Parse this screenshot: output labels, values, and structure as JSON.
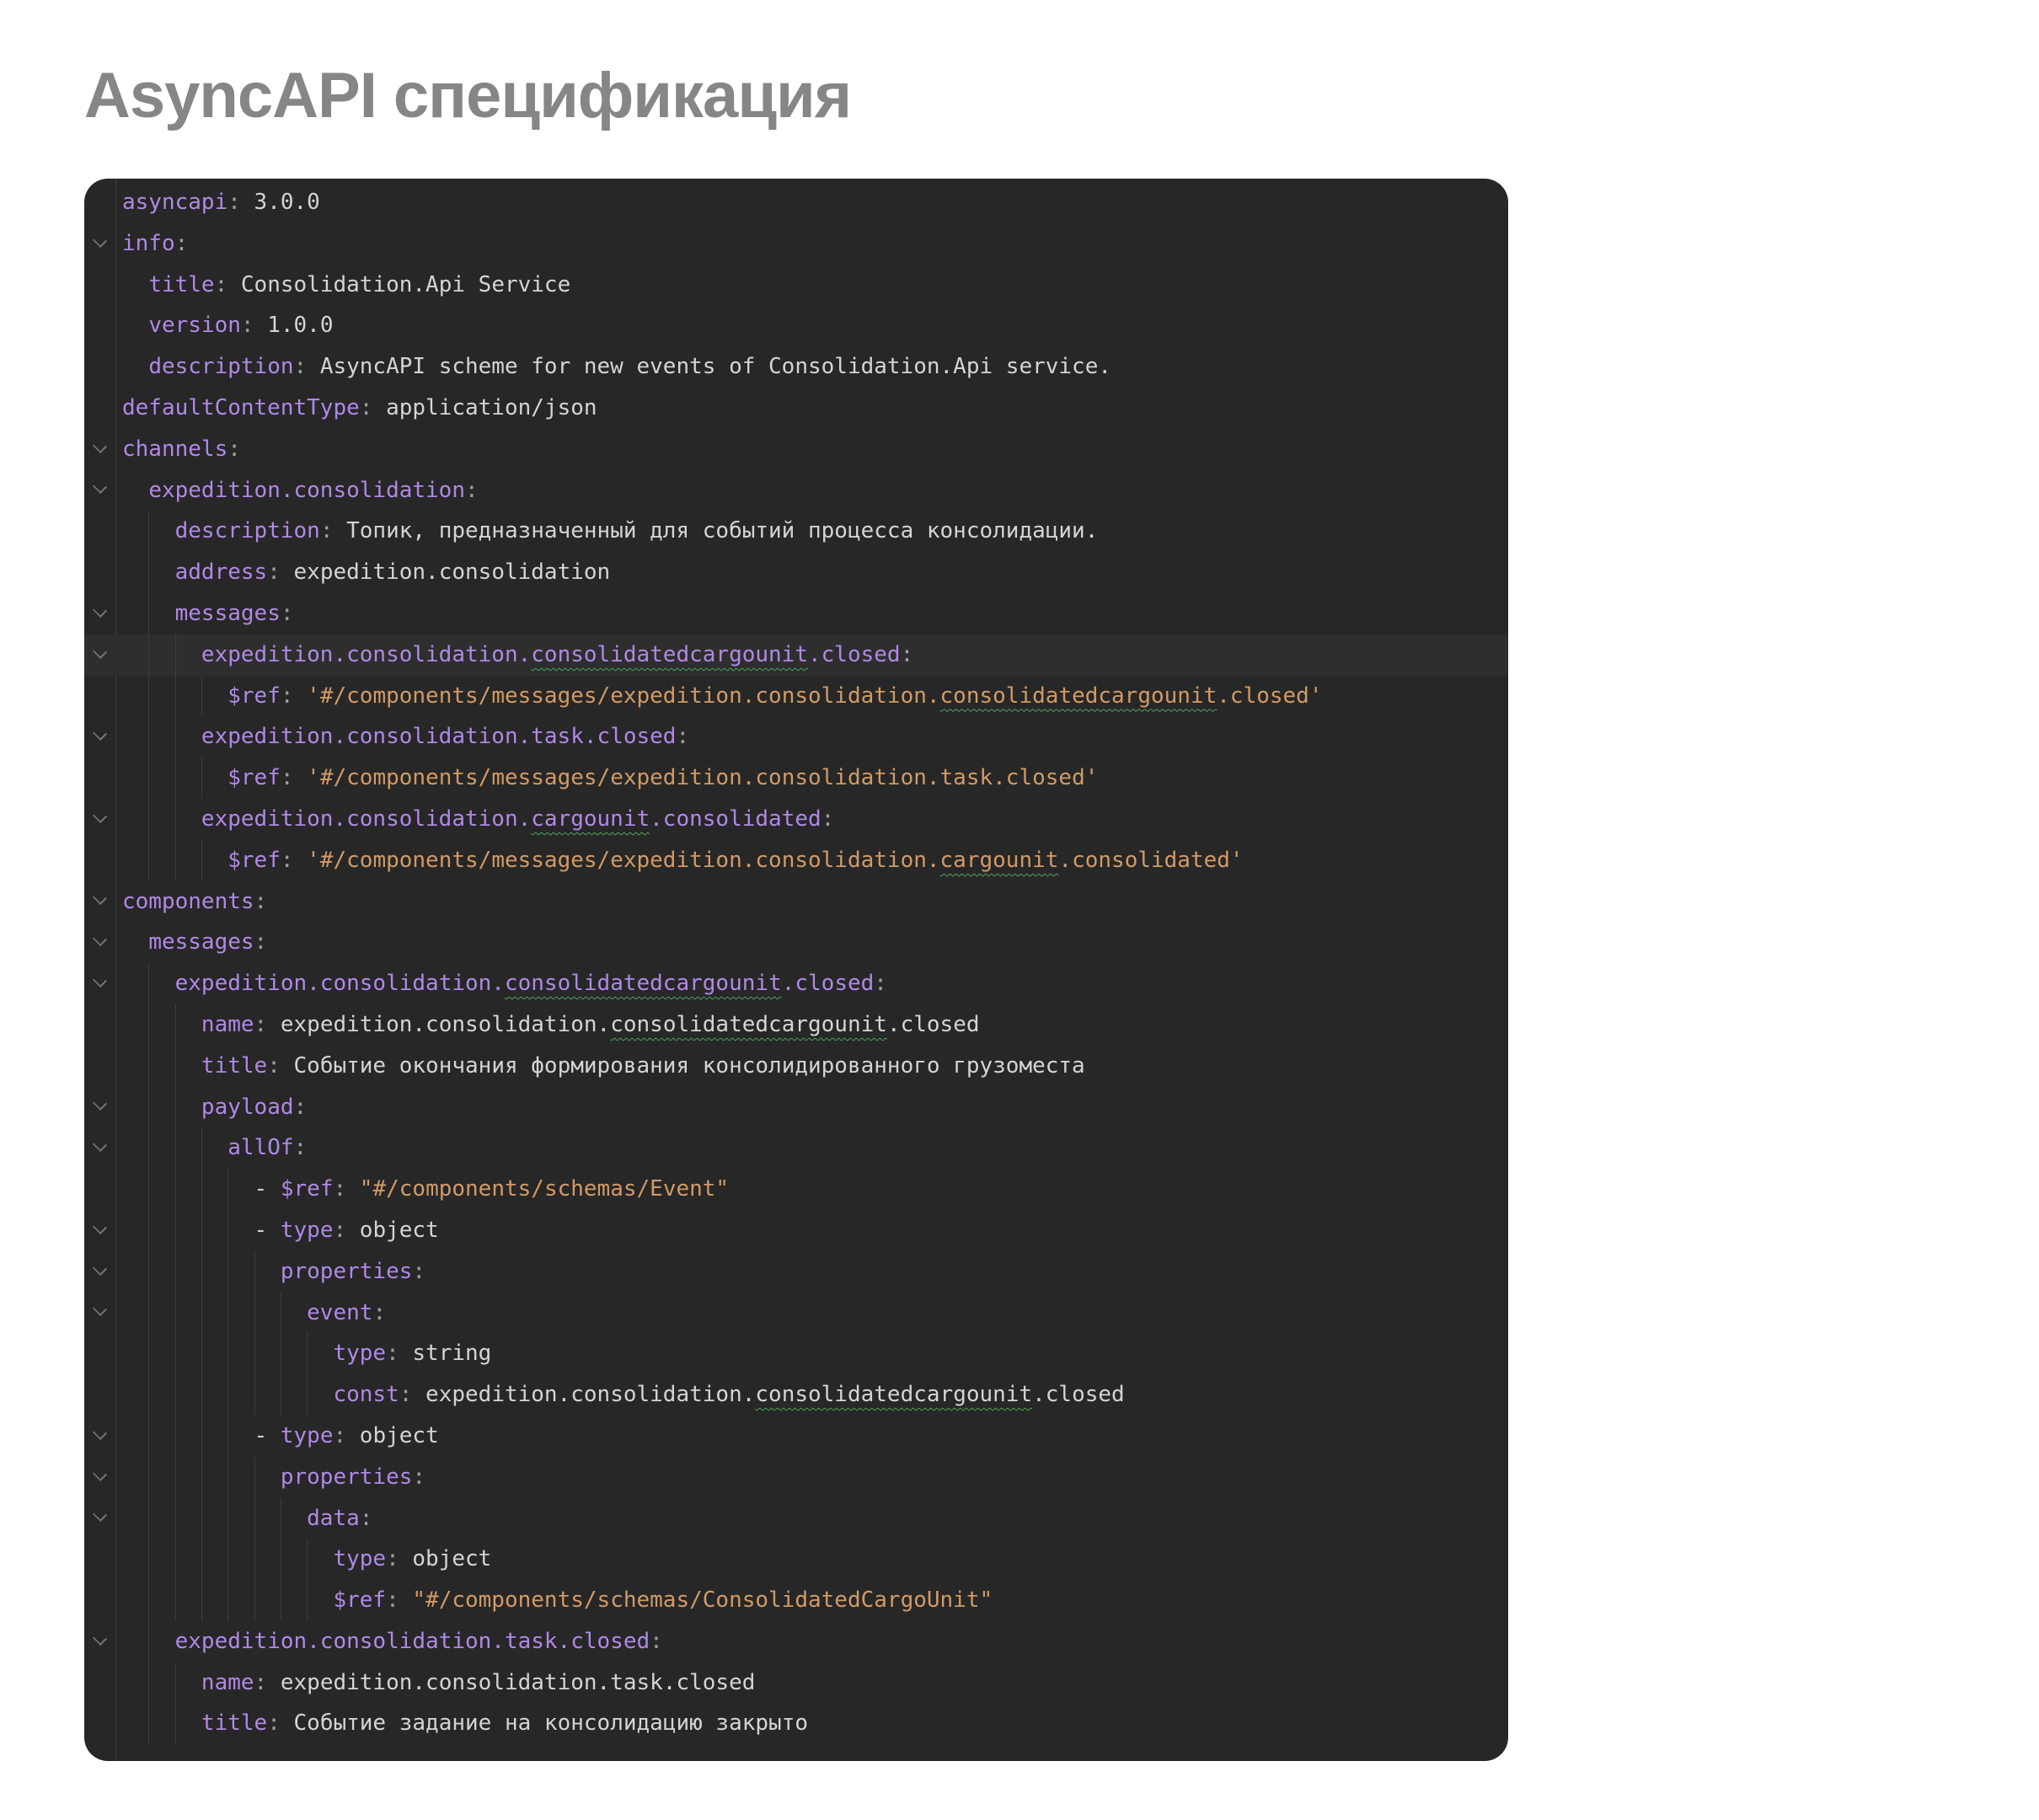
{
  "title": "AsyncAPI спецификация",
  "colors": {
    "heading": "#868686",
    "page-bg": "#ffffff",
    "code-bg": "#272727",
    "line-highlight": "#2e2e2e",
    "key": "#b088e6",
    "value": "#d4d4d4",
    "string": "#d19a66",
    "punct": "#9e9e9e",
    "guide": "#3d3d3d",
    "chevron": "#757575",
    "squiggle": "#4fa457"
  },
  "code": {
    "lines": [
      {
        "indent": 0,
        "fold": false,
        "highlight": false,
        "segments": [
          {
            "c": "key",
            "t": "asyncapi"
          },
          {
            "c": "punct",
            "t": ": "
          },
          {
            "c": "val",
            "t": "3.0.0"
          }
        ]
      },
      {
        "indent": 0,
        "fold": true,
        "highlight": false,
        "segments": [
          {
            "c": "key",
            "t": "info"
          },
          {
            "c": "punct",
            "t": ":"
          }
        ]
      },
      {
        "indent": 2,
        "fold": false,
        "highlight": false,
        "segments": [
          {
            "c": "key",
            "t": "title"
          },
          {
            "c": "punct",
            "t": ": "
          },
          {
            "c": "val",
            "t": "Consolidation.Api Service"
          }
        ]
      },
      {
        "indent": 2,
        "fold": false,
        "highlight": false,
        "segments": [
          {
            "c": "key",
            "t": "version"
          },
          {
            "c": "punct",
            "t": ": "
          },
          {
            "c": "val",
            "t": "1.0.0"
          }
        ]
      },
      {
        "indent": 2,
        "fold": false,
        "highlight": false,
        "segments": [
          {
            "c": "key",
            "t": "description"
          },
          {
            "c": "punct",
            "t": ": "
          },
          {
            "c": "val",
            "t": "AsyncAPI scheme for new events of Consolidation.Api service."
          }
        ]
      },
      {
        "indent": 0,
        "fold": false,
        "highlight": false,
        "segments": [
          {
            "c": "key",
            "t": "defaultContentType"
          },
          {
            "c": "punct",
            "t": ": "
          },
          {
            "c": "val",
            "t": "application/json"
          }
        ]
      },
      {
        "indent": 0,
        "fold": true,
        "highlight": false,
        "segments": [
          {
            "c": "key",
            "t": "channels"
          },
          {
            "c": "punct",
            "t": ":"
          }
        ]
      },
      {
        "indent": 2,
        "fold": true,
        "highlight": false,
        "segments": [
          {
            "c": "key",
            "t": "expedition.consolidation"
          },
          {
            "c": "punct",
            "t": ":"
          }
        ]
      },
      {
        "indent": 4,
        "fold": false,
        "highlight": false,
        "segments": [
          {
            "c": "key",
            "t": "description"
          },
          {
            "c": "punct",
            "t": ": "
          },
          {
            "c": "val",
            "t": "Топик, предназначенный для событий процесса консолидации."
          }
        ]
      },
      {
        "indent": 4,
        "fold": false,
        "highlight": false,
        "segments": [
          {
            "c": "key",
            "t": "address"
          },
          {
            "c": "punct",
            "t": ": "
          },
          {
            "c": "val",
            "t": "expedition.consolidation"
          }
        ]
      },
      {
        "indent": 4,
        "fold": true,
        "highlight": false,
        "segments": [
          {
            "c": "key",
            "t": "messages"
          },
          {
            "c": "punct",
            "t": ":"
          }
        ]
      },
      {
        "indent": 6,
        "fold": true,
        "highlight": true,
        "segments": [
          {
            "c": "key",
            "t": "expedition.consolidation."
          },
          {
            "c": "key",
            "t": "consolidatedcargounit",
            "w": true
          },
          {
            "c": "key",
            "t": ".closed"
          },
          {
            "c": "punct",
            "t": ":"
          }
        ]
      },
      {
        "indent": 8,
        "fold": false,
        "highlight": false,
        "segments": [
          {
            "c": "key",
            "t": "$ref"
          },
          {
            "c": "punct",
            "t": ": "
          },
          {
            "c": "str",
            "t": "'#/components/messages/expedition.consolidation."
          },
          {
            "c": "str",
            "t": "consolidatedcargounit",
            "w": true
          },
          {
            "c": "str",
            "t": ".closed'"
          }
        ]
      },
      {
        "indent": 6,
        "fold": true,
        "highlight": false,
        "segments": [
          {
            "c": "key",
            "t": "expedition.consolidation.task.closed"
          },
          {
            "c": "punct",
            "t": ":"
          }
        ]
      },
      {
        "indent": 8,
        "fold": false,
        "highlight": false,
        "segments": [
          {
            "c": "key",
            "t": "$ref"
          },
          {
            "c": "punct",
            "t": ": "
          },
          {
            "c": "str",
            "t": "'#/components/messages/expedition.consolidation.task.closed'"
          }
        ]
      },
      {
        "indent": 6,
        "fold": true,
        "highlight": false,
        "segments": [
          {
            "c": "key",
            "t": "expedition.consolidation."
          },
          {
            "c": "key",
            "t": "cargounit",
            "w": true
          },
          {
            "c": "key",
            "t": ".consolidated"
          },
          {
            "c": "punct",
            "t": ":"
          }
        ]
      },
      {
        "indent": 8,
        "fold": false,
        "highlight": false,
        "segments": [
          {
            "c": "key",
            "t": "$ref"
          },
          {
            "c": "punct",
            "t": ": "
          },
          {
            "c": "str",
            "t": "'#/components/messages/expedition.consolidation."
          },
          {
            "c": "str",
            "t": "cargounit",
            "w": true
          },
          {
            "c": "str",
            "t": ".consolidated'"
          }
        ]
      },
      {
        "indent": 0,
        "fold": true,
        "highlight": false,
        "segments": [
          {
            "c": "key",
            "t": "components"
          },
          {
            "c": "punct",
            "t": ":"
          }
        ]
      },
      {
        "indent": 2,
        "fold": true,
        "highlight": false,
        "segments": [
          {
            "c": "key",
            "t": "messages"
          },
          {
            "c": "punct",
            "t": ":"
          }
        ]
      },
      {
        "indent": 4,
        "fold": true,
        "highlight": false,
        "segments": [
          {
            "c": "key",
            "t": "expedition.consolidation."
          },
          {
            "c": "key",
            "t": "consolidatedcargounit",
            "w": true
          },
          {
            "c": "key",
            "t": ".closed"
          },
          {
            "c": "punct",
            "t": ":"
          }
        ]
      },
      {
        "indent": 6,
        "fold": false,
        "highlight": false,
        "segments": [
          {
            "c": "key",
            "t": "name"
          },
          {
            "c": "punct",
            "t": ": "
          },
          {
            "c": "val",
            "t": "expedition.consolidation."
          },
          {
            "c": "val",
            "t": "consolidatedcargounit",
            "w": true
          },
          {
            "c": "val",
            "t": ".closed"
          }
        ]
      },
      {
        "indent": 6,
        "fold": false,
        "highlight": false,
        "segments": [
          {
            "c": "key",
            "t": "title"
          },
          {
            "c": "punct",
            "t": ": "
          },
          {
            "c": "val",
            "t": "Событие окончания формирования консолидированного грузоместа"
          }
        ]
      },
      {
        "indent": 6,
        "fold": true,
        "highlight": false,
        "segments": [
          {
            "c": "key",
            "t": "payload"
          },
          {
            "c": "punct",
            "t": ":"
          }
        ]
      },
      {
        "indent": 8,
        "fold": true,
        "highlight": false,
        "segments": [
          {
            "c": "key",
            "t": "allOf"
          },
          {
            "c": "punct",
            "t": ":"
          }
        ]
      },
      {
        "indent": 10,
        "fold": false,
        "highlight": false,
        "segments": [
          {
            "c": "dash",
            "t": "- "
          },
          {
            "c": "key",
            "t": "$ref"
          },
          {
            "c": "punct",
            "t": ": "
          },
          {
            "c": "str",
            "t": "\"#/components/schemas/Event\""
          }
        ]
      },
      {
        "indent": 10,
        "fold": true,
        "highlight": false,
        "segments": [
          {
            "c": "dash",
            "t": "- "
          },
          {
            "c": "key",
            "t": "type"
          },
          {
            "c": "punct",
            "t": ": "
          },
          {
            "c": "val",
            "t": "object"
          }
        ]
      },
      {
        "indent": 12,
        "fold": true,
        "highlight": false,
        "segments": [
          {
            "c": "key",
            "t": "properties"
          },
          {
            "c": "punct",
            "t": ":"
          }
        ]
      },
      {
        "indent": 14,
        "fold": true,
        "highlight": false,
        "segments": [
          {
            "c": "key",
            "t": "event"
          },
          {
            "c": "punct",
            "t": ":"
          }
        ]
      },
      {
        "indent": 16,
        "fold": false,
        "highlight": false,
        "segments": [
          {
            "c": "key",
            "t": "type"
          },
          {
            "c": "punct",
            "t": ": "
          },
          {
            "c": "val",
            "t": "string"
          }
        ]
      },
      {
        "indent": 16,
        "fold": false,
        "highlight": false,
        "segments": [
          {
            "c": "key",
            "t": "const"
          },
          {
            "c": "punct",
            "t": ": "
          },
          {
            "c": "val",
            "t": "expedition.consolidation."
          },
          {
            "c": "val",
            "t": "consolidatedcargounit",
            "w": true
          },
          {
            "c": "val",
            "t": ".closed"
          }
        ]
      },
      {
        "indent": 10,
        "fold": true,
        "highlight": false,
        "segments": [
          {
            "c": "dash",
            "t": "- "
          },
          {
            "c": "key",
            "t": "type"
          },
          {
            "c": "punct",
            "t": ": "
          },
          {
            "c": "val",
            "t": "object"
          }
        ]
      },
      {
        "indent": 12,
        "fold": true,
        "highlight": false,
        "segments": [
          {
            "c": "key",
            "t": "properties"
          },
          {
            "c": "punct",
            "t": ":"
          }
        ]
      },
      {
        "indent": 14,
        "fold": true,
        "highlight": false,
        "segments": [
          {
            "c": "key",
            "t": "data"
          },
          {
            "c": "punct",
            "t": ":"
          }
        ]
      },
      {
        "indent": 16,
        "fold": false,
        "highlight": false,
        "segments": [
          {
            "c": "key",
            "t": "type"
          },
          {
            "c": "punct",
            "t": ": "
          },
          {
            "c": "val",
            "t": "object"
          }
        ]
      },
      {
        "indent": 16,
        "fold": false,
        "highlight": false,
        "segments": [
          {
            "c": "key",
            "t": "$ref"
          },
          {
            "c": "punct",
            "t": ": "
          },
          {
            "c": "str",
            "t": "\"#/components/schemas/ConsolidatedCargoUnit\""
          }
        ]
      },
      {
        "indent": 4,
        "fold": true,
        "highlight": false,
        "segments": [
          {
            "c": "key",
            "t": "expedition.consolidation.task.closed"
          },
          {
            "c": "punct",
            "t": ":"
          }
        ]
      },
      {
        "indent": 6,
        "fold": false,
        "highlight": false,
        "segments": [
          {
            "c": "key",
            "t": "name"
          },
          {
            "c": "punct",
            "t": ": "
          },
          {
            "c": "val",
            "t": "expedition.consolidation.task.closed"
          }
        ]
      },
      {
        "indent": 6,
        "fold": false,
        "highlight": false,
        "segments": [
          {
            "c": "key",
            "t": "title"
          },
          {
            "c": "punct",
            "t": ": "
          },
          {
            "c": "val",
            "t": "Событие задание на консолидацию закрыто"
          }
        ]
      }
    ]
  }
}
